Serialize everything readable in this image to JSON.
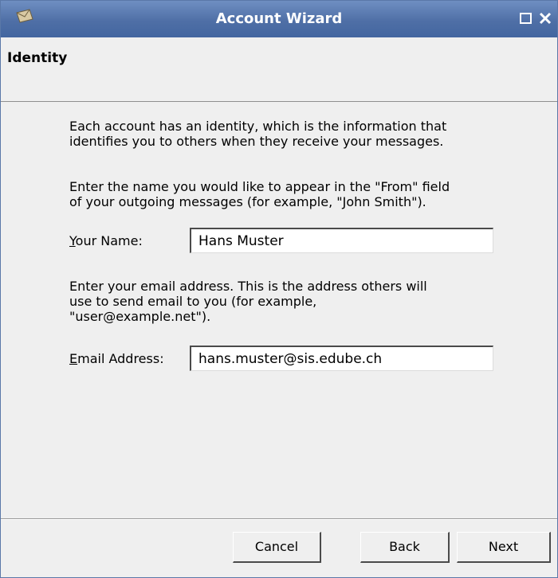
{
  "window": {
    "title": "Account Wizard",
    "icon": "mail-envelope-icon"
  },
  "titlebar_buttons": [
    {
      "name": "maximize",
      "icon": "maximize-icon"
    },
    {
      "name": "close",
      "icon": "close-icon"
    }
  ],
  "header": {
    "title": "Identity"
  },
  "intro": {
    "lines": [
      "Each account has an identity, which is the information that",
      "identifies you to others when they receive your messages."
    ]
  },
  "name_section": {
    "lines": [
      "Enter the name you would like to appear in the \"From\" field",
      "of your outgoing messages (for example, \"John Smith\")."
    ],
    "label_mnemonic": "Y",
    "label_rest": "our Name:",
    "value": "Hans Muster"
  },
  "email_section": {
    "lines": [
      "Enter your email address. This is the address others will",
      "use to send email to you (for example,",
      "\"user@example.net\")."
    ],
    "label_mnemonic": "E",
    "label_rest": "mail Address:",
    "value": "hans.muster@sis.edube.ch"
  },
  "buttons": {
    "cancel": "Cancel",
    "back": "Back",
    "next": "Next"
  },
  "colors": {
    "titlebar": "#4f6fa6",
    "background": "#efefef"
  }
}
